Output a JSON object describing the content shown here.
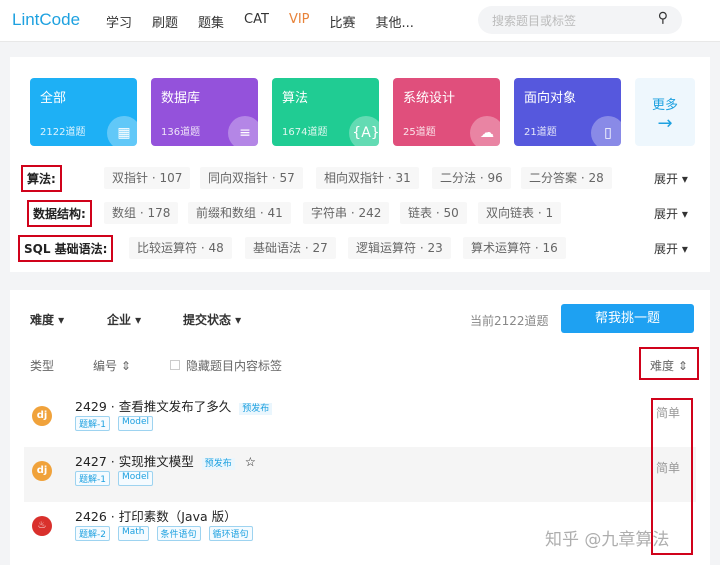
{
  "header": {
    "logo": "LintCode",
    "nav": [
      "学习",
      "刷题",
      "题集",
      "CAT",
      "VIP",
      "比赛",
      "其他..."
    ],
    "search_placeholder": "搜索题目或标签",
    "vip_color": "#e8833a"
  },
  "categories": [
    {
      "title": "全部",
      "count": "2122道题",
      "color": "#1eb0f5",
      "icon": "grid-icon"
    },
    {
      "title": "数据库",
      "count": "136道题",
      "color": "#9452db",
      "icon": "database-icon"
    },
    {
      "title": "算法",
      "count": "1674道题",
      "color": "#20cc93",
      "icon": "braces-icon"
    },
    {
      "title": "系统设计",
      "count": "25道题",
      "color": "#e04f7c",
      "icon": "cloud-icon"
    },
    {
      "title": "面向对象",
      "count": "21道题",
      "color": "#5658dd",
      "icon": "object-icon"
    }
  ],
  "more": {
    "label": "更多",
    "arrow": "→"
  },
  "tag_rows": [
    {
      "label": "算法:",
      "tags": [
        "双指针 · 107",
        "同向双指针 · 57",
        "相向双指针 · 31",
        "二分法 · 96",
        "二分答案 · 28"
      ],
      "expand": "展开 ▾"
    },
    {
      "label": "数据结构:",
      "tags": [
        "数组 · 178",
        "前缀和数组 · 41",
        "字符串 · 242",
        "链表 · 50",
        "双向链表 · 1"
      ],
      "expand": "展开 ▾"
    },
    {
      "label": "SQL 基础语法:",
      "tags": [
        "比较运算符 · 48",
        "基础语法 · 27",
        "逻辑运算符 · 23",
        "算术运算符 · 16"
      ],
      "expand": "展开 ▾"
    }
  ],
  "filters": {
    "items": [
      "难度 ▾",
      "企业 ▾",
      "提交状态 ▾"
    ],
    "count": "当前2122道题",
    "pick_button": "帮我挑一题"
  },
  "table_header": {
    "type": "类型",
    "number": "编号 ⇕",
    "hide_tags": "隐藏题目内容标签",
    "difficulty": "难度 ⇕"
  },
  "problems": [
    {
      "title": "2429 · 查看推文发布了多久",
      "badge": "预发布",
      "star": "",
      "tags": [
        "题解-1",
        "Model"
      ],
      "difficulty": "简单",
      "avatar": "dj",
      "avatar_color": "#f0a23b"
    },
    {
      "title": "2427 · 实现推文模型",
      "badge": "预发布",
      "star": "☆",
      "tags": [
        "题解-1",
        "Model"
      ],
      "difficulty": "简单",
      "avatar": "dj",
      "avatar_color": "#f0a23b"
    },
    {
      "title": "2426 · 打印素数（Java 版）",
      "badge": "",
      "star": "",
      "tags": [
        "题解-2",
        "Math",
        "条件语句",
        "循环语句"
      ],
      "difficulty": "",
      "avatar": "♨",
      "avatar_color": "#d9302c"
    }
  ],
  "watermark": "知乎 @九章算法"
}
